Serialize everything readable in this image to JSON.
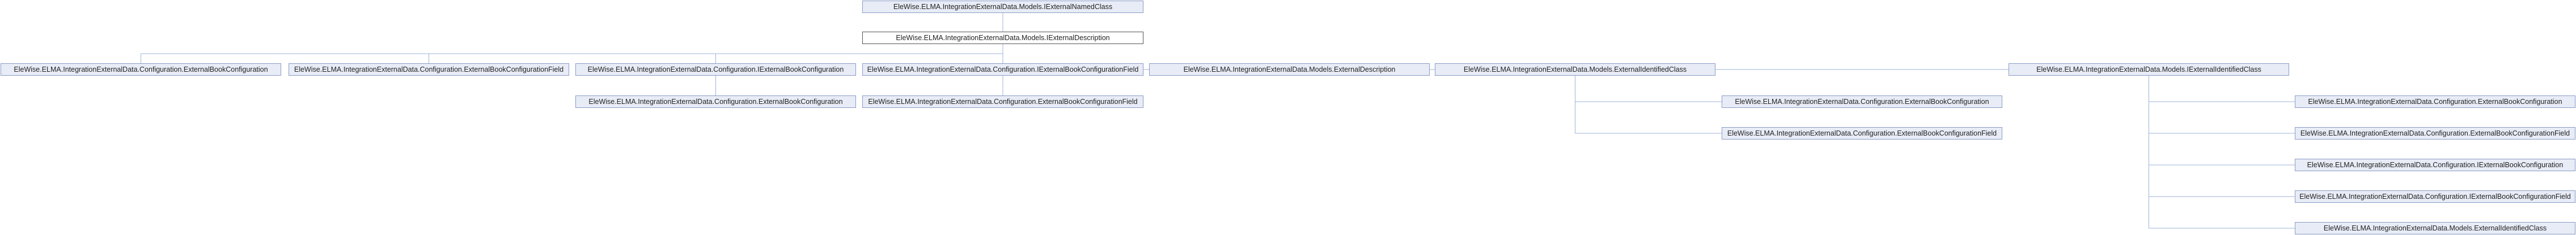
{
  "diagram": {
    "title": "",
    "nodes": [
      {
        "id": "n1",
        "label": "EleWise.ELMA.IntegrationExternalData.Models.IExternalNamedClass"
      },
      {
        "id": "n2",
        "label": "EleWise.ELMA.IntegrationExternalData.Models.IExternalDescription",
        "current": true
      },
      {
        "id": "n3",
        "label": "EleWise.ELMA.IntegrationExternalData.Configuration.ExternalBookConfiguration"
      },
      {
        "id": "n4",
        "label": "EleWise.ELMA.IntegrationExternalData.Configuration.ExternalBookConfigurationField"
      },
      {
        "id": "n5",
        "label": "EleWise.ELMA.IntegrationExternalData.Configuration.IExternalBookConfiguration"
      },
      {
        "id": "n6",
        "label": "EleWise.ELMA.IntegrationExternalData.Configuration.IExternalBookConfigurationField"
      },
      {
        "id": "n7",
        "label": "EleWise.ELMA.IntegrationExternalData.Models.ExternalDescription"
      },
      {
        "id": "n8",
        "label": "EleWise.ELMA.IntegrationExternalData.Models.ExternalIdentifiedClass"
      },
      {
        "id": "n9",
        "label": "EleWise.ELMA.IntegrationExternalData.Models.IExternalIdentifiedClass"
      },
      {
        "id": "n10",
        "label": "EleWise.ELMA.IntegrationExternalData.Configuration.ExternalBookConfiguration"
      },
      {
        "id": "n11",
        "label": "EleWise.ELMA.IntegrationExternalData.Configuration.ExternalBookConfigurationField"
      },
      {
        "id": "n12",
        "label": "EleWise.ELMA.IntegrationExternalData.Configuration.ExternalBookConfiguration"
      },
      {
        "id": "n13",
        "label": "EleWise.ELMA.IntegrationExternalData.Configuration.ExternalBookConfigurationField"
      },
      {
        "id": "n14",
        "label": "EleWise.ELMA.IntegrationExternalData.Configuration.ExternalBookConfiguration"
      },
      {
        "id": "n15",
        "label": "EleWise.ELMA.IntegrationExternalData.Configuration.ExternalBookConfigurationField"
      },
      {
        "id": "n16",
        "label": "EleWise.ELMA.IntegrationExternalData.Configuration.IExternalBookConfiguration"
      },
      {
        "id": "n17",
        "label": "EleWise.ELMA.IntegrationExternalData.Configuration.IExternalBookConfigurationField"
      },
      {
        "id": "n18",
        "label": "EleWise.ELMA.IntegrationExternalData.Models.ExternalIdentifiedClass"
      }
    ],
    "edges": [
      [
        "n1",
        "n2"
      ],
      [
        "n2",
        "n3"
      ],
      [
        "n2",
        "n4"
      ],
      [
        "n2",
        "n5"
      ],
      [
        "n2",
        "n6"
      ],
      [
        "n2",
        "n7"
      ],
      [
        "n2",
        "n8"
      ],
      [
        "n2",
        "n9"
      ],
      [
        "n5",
        "n10"
      ],
      [
        "n6",
        "n11"
      ],
      [
        "n8",
        "n12"
      ],
      [
        "n8",
        "n13"
      ],
      [
        "n9",
        "n14"
      ],
      [
        "n9",
        "n15"
      ],
      [
        "n9",
        "n16"
      ],
      [
        "n9",
        "n17"
      ],
      [
        "n9",
        "n18"
      ]
    ],
    "colors": {
      "node_fill": "#e8ecf6",
      "node_border": "#8a9bc6",
      "edge": "#9fb3d9",
      "current_fill": "#ffffff",
      "current_border": "#555555"
    }
  }
}
